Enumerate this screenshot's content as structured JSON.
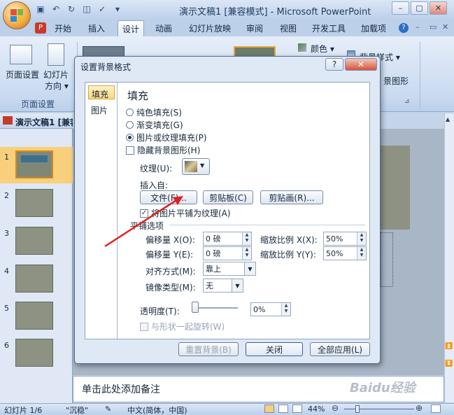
{
  "window": {
    "title": "演示文稿1 [兼容模式] - Microsoft PowerPoint"
  },
  "qat": {
    "icons": [
      "save-icon",
      "undo-icon",
      "redo-icon",
      "preview-icon",
      "spell-icon",
      "more-icon"
    ]
  },
  "window_controls": {
    "minimize": "–",
    "restore": "▢",
    "close": "✕"
  },
  "tabs": [
    "开始",
    "插入",
    "设计",
    "动画",
    "幻灯片放映",
    "审阅",
    "视图",
    "开发工具",
    "加载项"
  ],
  "ribbon": {
    "page_setup_btn": "页面设置",
    "orientation_btn_line1": "幻灯片",
    "orientation_btn_line2": "方向",
    "group_label": "页面设置",
    "colors_btn": "颜色",
    "bg_styles_btn": "背景样式",
    "hide_bg_btn": "景图形"
  },
  "pane": {
    "tab_slides": "演示文稿1 [兼容"
  },
  "thumbnails": [
    "1",
    "2",
    "3",
    "4",
    "5",
    "6"
  ],
  "dialog": {
    "title": "设置背景格式",
    "help_btn": "?",
    "close_btn": "✕",
    "nav": [
      "填充",
      "图片"
    ],
    "section_fill": "填充",
    "radio_solid": "纯色填充(S)",
    "radio_gradient": "渐变填充(G)",
    "radio_picture": "图片或纹理填充(P)",
    "check_hide": "隐藏背景图形(H)",
    "texture_label": "纹理(U):",
    "insert_from": "插入自:",
    "btn_file": "文件(F)...",
    "btn_clipboard": "剪贴板(C)",
    "btn_clipart": "剪贴画(R)...",
    "check_tile": "将图片平铺为纹理(A)",
    "tile_options": "平铺选项",
    "offset_x_label": "偏移量 X(O):",
    "offset_x_val": "0 磅",
    "scale_x_label": "缩放比例 X(X):",
    "scale_x_val": "50%",
    "offset_y_label": "偏移量 Y(E):",
    "offset_y_val": "0 磅",
    "scale_y_label": "缩放比例 Y(Y):",
    "scale_y_val": "50%",
    "align_label": "对齐方式(M):",
    "align_val": "靠上",
    "mirror_label": "镜像类型(M):",
    "mirror_val": "无",
    "transparency_label": "透明度(T):",
    "transparency_val": "0%",
    "transparency_level": 0,
    "check_rotate": "与形状一起旋转(W)",
    "btn_reset": "重置背景(B)",
    "btn_close": "关闭",
    "btn_apply_all": "全部应用(L)"
  },
  "notes_placeholder": "单击此处添加备注",
  "status": {
    "slide": "幻灯片 1/6",
    "theme": "\"沉稳\"",
    "lang": "中文(简体，中国)",
    "zoom": "44%"
  },
  "watermark": "Baidu经验",
  "annotation_arrow_color": "#e02020"
}
